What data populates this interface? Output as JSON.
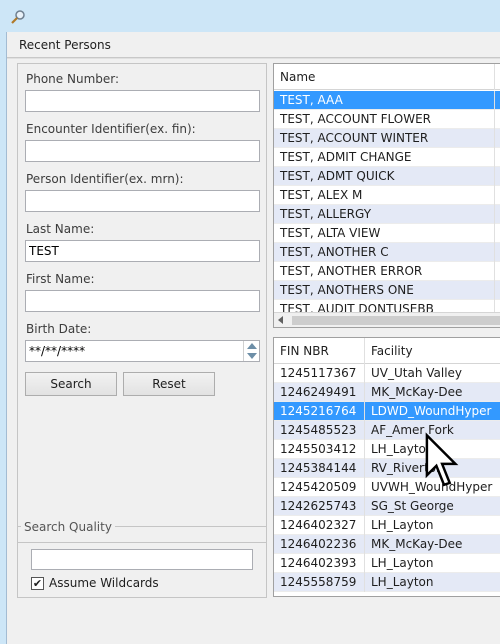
{
  "window": {
    "section_title": "Recent Persons"
  },
  "search_form": {
    "phone_label": "Phone Number:",
    "phone_value": "",
    "encounter_label": "Encounter Identifier(ex. fin):",
    "encounter_value": "",
    "person_label": "Person Identifier(ex. mrn):",
    "person_value": "",
    "last_name_label": "Last Name:",
    "last_name_value": "TEST",
    "first_name_label": "First Name:",
    "first_name_value": "",
    "birth_date_label": "Birth Date:",
    "birth_date_value": "**/**/****",
    "search_button": "Search",
    "reset_button": "Reset"
  },
  "search_quality": {
    "legend": "Search Quality",
    "value": "",
    "wildcards_label": "Assume Wildcards",
    "wildcards_checked": true,
    "check_glyph": "✔"
  },
  "persons_grid": {
    "header": "Name",
    "rows": [
      "TEST, AAA",
      "TEST, ACCOUNT FLOWER",
      "TEST, ACCOUNT WINTER",
      "TEST, ADMIT CHANGE",
      "TEST, ADMT QUICK",
      "TEST, ALEX M",
      "TEST, ALLERGY",
      "TEST, ALTA VIEW",
      "TEST, ANOTHER C",
      "TEST, ANOTHER ERROR",
      "TEST, ANOTHERS ONE",
      "TEST, AUDIT DONTUSEBB"
    ],
    "selected_index": 0
  },
  "encounters_grid": {
    "headers": [
      "FIN NBR",
      "Facility"
    ],
    "rows": [
      [
        "1245117367",
        "UV_Utah Valley"
      ],
      [
        "1246249491",
        "MK_McKay-Dee"
      ],
      [
        "1245216764",
        "LDWD_WoundHyper"
      ],
      [
        "1245485523",
        "AF_Amer Fork"
      ],
      [
        "1245503412",
        "LH_Layton"
      ],
      [
        "1245384144",
        "RV_Riverton"
      ],
      [
        "1245420509",
        "UVWH_WoundHyper"
      ],
      [
        "1242625743",
        "SG_St George"
      ],
      [
        "1246402327",
        "LH_Layton"
      ],
      [
        "1246402236",
        "MK_McKay-Dee"
      ],
      [
        "1246402393",
        "LH_Layton"
      ],
      [
        "1245558759",
        "LH_Layton"
      ]
    ],
    "selected_index": 2
  },
  "colors": {
    "selection": "#3399ff",
    "alt_row": "#e4e9f6",
    "background": "#cde6f7"
  }
}
